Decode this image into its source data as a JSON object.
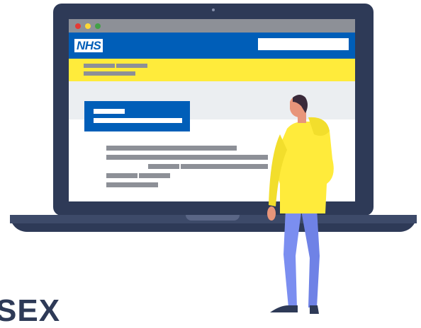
{
  "browser": {
    "traffic_lights": [
      {
        "name": "close",
        "color": "#e53935"
      },
      {
        "name": "minimize",
        "color": "#fdd835"
      },
      {
        "name": "maximize",
        "color": "#43a047"
      }
    ]
  },
  "header": {
    "logo_text": "NHS",
    "search": {
      "value": "",
      "placeholder": ""
    }
  },
  "bottom_text": "SEX",
  "colors": {
    "nhs_blue": "#005eb8",
    "banner_yellow": "#ffeb3b",
    "laptop_navy": "#2e3a57",
    "placeholder_grey": "#8d9097",
    "person_jacket": "#ffeb3b",
    "person_trousers": "#7b8ef0",
    "person_skin": "#e8957a",
    "person_hair": "#3a2a3a"
  },
  "illustration": {
    "subject": "person-standing-looking-at-laptop-icon"
  }
}
